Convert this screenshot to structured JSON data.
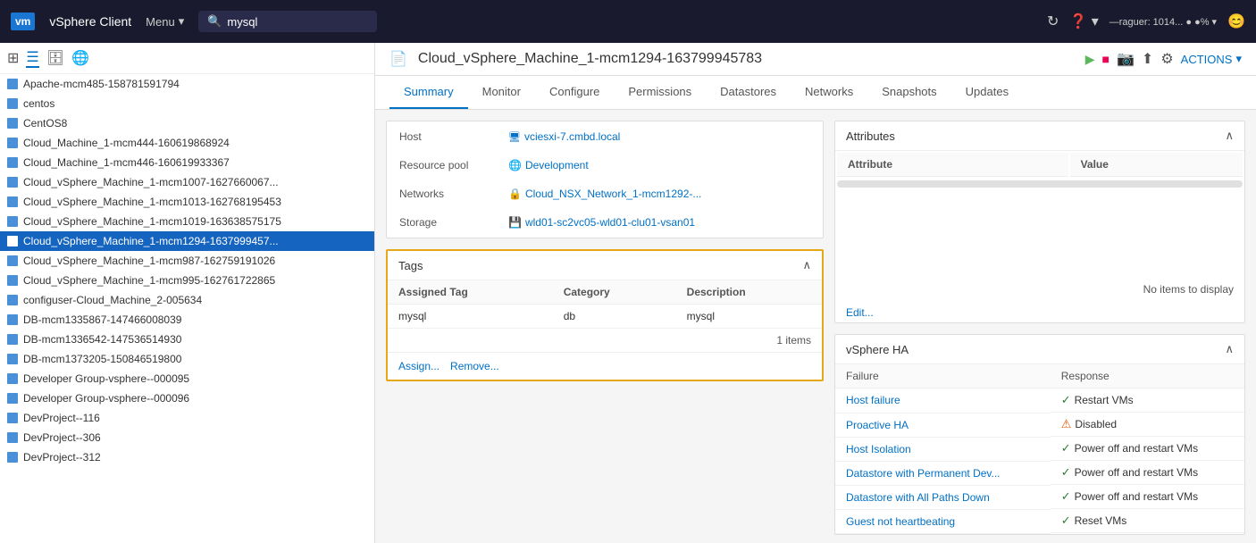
{
  "topNav": {
    "logo": "vm",
    "appTitle": "vSphere Client",
    "menuLabel": "Menu",
    "searchPlaceholder": "mysql",
    "helpLabel": "?",
    "actionsLabel": "ACTIONS"
  },
  "sidebar": {
    "items": [
      {
        "id": "apache",
        "label": "Apache-mcm485-158781591794",
        "icon": "vm"
      },
      {
        "id": "centos",
        "label": "centos",
        "icon": "vm"
      },
      {
        "id": "centos8",
        "label": "CentOS8",
        "icon": "vm"
      },
      {
        "id": "cloud-machine-444",
        "label": "Cloud_Machine_1-mcm444-160619868924",
        "icon": "vm"
      },
      {
        "id": "cloud-machine-446",
        "label": "Cloud_Machine_1-mcm446-160619933367",
        "icon": "vm"
      },
      {
        "id": "cloud-vsphere-1007",
        "label": "Cloud_vSphere_Machine_1-mcm1007-1627660067...",
        "icon": "vm"
      },
      {
        "id": "cloud-vsphere-1013",
        "label": "Cloud_vSphere_Machine_1-mcm1013-162768195453",
        "icon": "vm"
      },
      {
        "id": "cloud-vsphere-1019",
        "label": "Cloud_vSphere_Machine_1-mcm1019-163638575175",
        "icon": "vm"
      },
      {
        "id": "cloud-vsphere-1294",
        "label": "Cloud_vSphere_Machine_1-mcm1294-1637999457...",
        "icon": "vm",
        "selected": true
      },
      {
        "id": "cloud-vsphere-987",
        "label": "Cloud_vSphere_Machine_1-mcm987-162759191026",
        "icon": "vm"
      },
      {
        "id": "cloud-vsphere-995",
        "label": "Cloud_vSphere_Machine_1-mcm995-162761722865",
        "icon": "vm"
      },
      {
        "id": "configuser",
        "label": "configuser-Cloud_Machine_2-005634",
        "icon": "vm"
      },
      {
        "id": "db-1335867",
        "label": "DB-mcm1335867-147466008039",
        "icon": "vm"
      },
      {
        "id": "db-1336542",
        "label": "DB-mcm1336542-147536514930",
        "icon": "vm"
      },
      {
        "id": "db-1373205",
        "label": "DB-mcm1373205-150846519800",
        "icon": "vm"
      },
      {
        "id": "dev-group-95",
        "label": "Developer Group-vsphere--000095",
        "icon": "vm"
      },
      {
        "id": "dev-group-96",
        "label": "Developer Group-vsphere--000096",
        "icon": "vm"
      },
      {
        "id": "devproject-116",
        "label": "DevProject--116",
        "icon": "vm"
      },
      {
        "id": "devproject-306",
        "label": "DevProject--306",
        "icon": "vm"
      },
      {
        "id": "devproject-312",
        "label": "DevProject--312",
        "icon": "vm"
      }
    ]
  },
  "contentHeader": {
    "title": "Cloud_vSphere_Machine_1-mcm1294-163799945783",
    "actionsLabel": "ACTIONS"
  },
  "tabs": [
    {
      "id": "summary",
      "label": "Summary",
      "active": true
    },
    {
      "id": "monitor",
      "label": "Monitor"
    },
    {
      "id": "configure",
      "label": "Configure"
    },
    {
      "id": "permissions",
      "label": "Permissions"
    },
    {
      "id": "datastores",
      "label": "Datastores"
    },
    {
      "id": "networks",
      "label": "Networks"
    },
    {
      "id": "snapshots",
      "label": "Snapshots"
    },
    {
      "id": "updates",
      "label": "Updates"
    }
  ],
  "vmInfo": {
    "host": {
      "label": "Host",
      "value": "vciesxi-7.cmbd.local"
    },
    "resourcePool": {
      "label": "Resource pool",
      "value": "Development"
    },
    "networks": {
      "label": "Networks",
      "value": "Cloud_NSX_Network_1-mcm1292-..."
    },
    "storage": {
      "label": "Storage",
      "value": "wld01-sc2vc05-wld01-clu01-vsan01"
    }
  },
  "tags": {
    "title": "Tags",
    "columns": [
      "Assigned Tag",
      "Category",
      "Description"
    ],
    "rows": [
      {
        "tag": "mysql",
        "category": "db",
        "description": "mysql"
      }
    ],
    "itemCount": "1 items",
    "assignLabel": "Assign...",
    "removeLabel": "Remove..."
  },
  "attributes": {
    "title": "Attributes",
    "columns": [
      "Attribute",
      "Value"
    ],
    "noItems": "No items to display",
    "editLabel": "Edit..."
  },
  "vSphereHA": {
    "title": "vSphere HA",
    "columns": [
      "Failure",
      "Response"
    ],
    "rows": [
      {
        "failure": "Host failure",
        "response": "Restart VMs",
        "status": "ok"
      },
      {
        "failure": "Proactive HA",
        "response": "Disabled",
        "status": "warn"
      },
      {
        "failure": "Host Isolation",
        "response": "Power off and restart VMs",
        "status": "ok"
      },
      {
        "failure": "Datastore with Permanent Dev...",
        "response": "Power off and restart VMs",
        "status": "ok"
      },
      {
        "failure": "Datastore with All Paths Down",
        "response": "Power off and restart VMs",
        "status": "ok"
      },
      {
        "failure": "Guest not heartbeating",
        "response": "Reset VMs",
        "status": "ok"
      }
    ]
  }
}
